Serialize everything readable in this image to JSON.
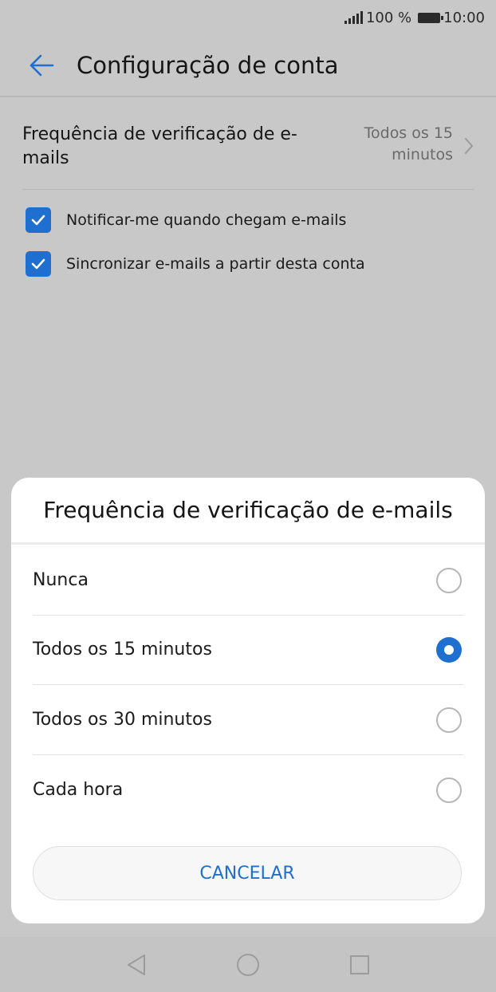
{
  "status_bar": {
    "battery_text": "100 %",
    "time": "10:00",
    "signal_icon": "signal-bars-icon",
    "battery_icon": "battery-icon"
  },
  "app_bar": {
    "title": "Configuração de conta",
    "back_icon": "back-arrow-icon"
  },
  "settings": {
    "frequency": {
      "label": "Frequência de verificação de e-mails",
      "value": "Todos os 15 minutos",
      "icon": "chevron-right-icon"
    },
    "checkboxes": [
      {
        "label": "Notificar-me quando chegam e-mails",
        "checked": true
      },
      {
        "label": "Sincronizar e-mails a partir desta conta",
        "checked": true
      }
    ]
  },
  "dialog": {
    "title": "Frequência de verificação de e-mails",
    "options": [
      {
        "label": "Nunca",
        "selected": false
      },
      {
        "label": "Todos os 15 minutos",
        "selected": true
      },
      {
        "label": "Todos os 30 minutos",
        "selected": false
      },
      {
        "label": "Cada hora",
        "selected": false
      }
    ],
    "cancel_label": "CANCELAR"
  },
  "nav_bar": {
    "icons": [
      "back-triangle-icon",
      "home-circle-icon",
      "recents-square-icon"
    ]
  },
  "colors": {
    "accent": "#1e6fd0",
    "scrim_background": "#c8c8c8",
    "dialog_background": "#ffffff"
  }
}
